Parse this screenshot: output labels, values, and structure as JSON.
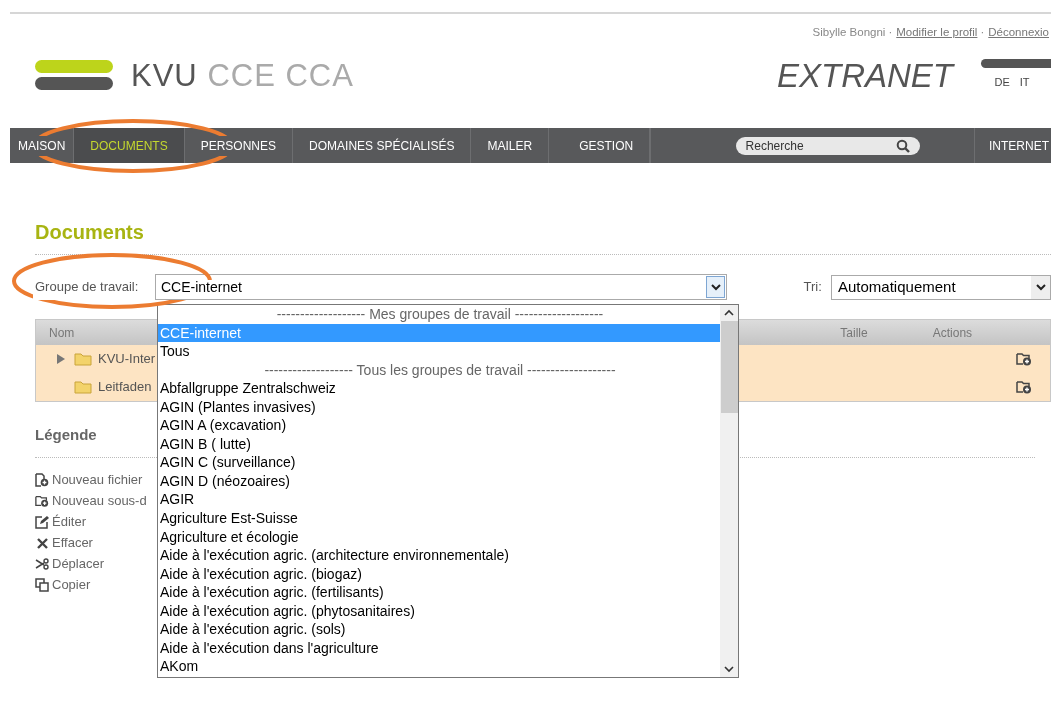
{
  "header": {
    "logo": {
      "primary": "KVU",
      "secondary": "CCE CCA"
    },
    "user": "Sibylle Bongni",
    "separator": "·",
    "links": [
      "Modifier le profil",
      "Déconnexio"
    ],
    "site_title": "EXTRANET",
    "languages": [
      "DE",
      "IT"
    ]
  },
  "nav": {
    "items": [
      {
        "label": "MAISON",
        "selected": false
      },
      {
        "label": "DOCUMENTS",
        "selected": true
      },
      {
        "label": "PERSONNES",
        "selected": false
      },
      {
        "label": "DOMAINES SPÉCIALISÉS",
        "selected": false
      },
      {
        "label": "MAILER",
        "selected": false
      },
      {
        "label": "GESTION",
        "selected": false
      }
    ],
    "search": {
      "placeholder": "Recherche"
    },
    "external_link": "INTERNET"
  },
  "page_title": "Documents",
  "filter": {
    "label": "Groupe de travail:",
    "value": "CCE-internet"
  },
  "sort": {
    "label": "Tri:",
    "value": "Automatiquement"
  },
  "table": {
    "columns": [
      "Nom",
      "Taille",
      "Actions"
    ],
    "rows": [
      {
        "name": "KVU-Inter",
        "expandable": true
      },
      {
        "name": "Leitfaden",
        "expandable": false
      }
    ]
  },
  "legend": {
    "title": "Légende",
    "items": [
      {
        "kind": "new-file",
        "label": "Nouveau fichier"
      },
      {
        "kind": "new-folder",
        "label": "Nouveau sous-d"
      },
      {
        "kind": "edit",
        "label": "Éditer"
      },
      {
        "kind": "delete",
        "label": "Effacer"
      },
      {
        "kind": "move",
        "label": "Déplacer"
      },
      {
        "kind": "copy",
        "label": "Copier"
      }
    ]
  },
  "dropdown": {
    "options": [
      {
        "kind": "group",
        "label": "------------------- Mes groupes de travail -------------------",
        "selected": false
      },
      {
        "kind": "option",
        "label": "CCE-internet",
        "selected": true
      },
      {
        "kind": "option",
        "label": "Tous",
        "selected": false
      },
      {
        "kind": "group",
        "label": "------------------- Tous les groupes de travail -------------------",
        "selected": false
      },
      {
        "kind": "option",
        "label": "Abfallgruppe Zentralschweiz",
        "selected": false
      },
      {
        "kind": "option",
        "label": "AGIN (Plantes invasives)",
        "selected": false
      },
      {
        "kind": "option",
        "label": "AGIN A (excavation)",
        "selected": false
      },
      {
        "kind": "option",
        "label": "AGIN B ( lutte)",
        "selected": false
      },
      {
        "kind": "option",
        "label": "AGIN C (surveillance)",
        "selected": false
      },
      {
        "kind": "option",
        "label": "AGIN D (néozoaires)",
        "selected": false
      },
      {
        "kind": "option",
        "label": "AGIR",
        "selected": false
      },
      {
        "kind": "option",
        "label": "Agriculture Est-Suisse",
        "selected": false
      },
      {
        "kind": "option",
        "label": "Agriculture et écologie",
        "selected": false
      },
      {
        "kind": "option",
        "label": "Aide à l'exécution agric. (architecture environnementale)",
        "selected": false
      },
      {
        "kind": "option",
        "label": "Aide à l'exécution agric. (biogaz)",
        "selected": false
      },
      {
        "kind": "option",
        "label": "Aide à l'exécution agric. (fertilisants)",
        "selected": false
      },
      {
        "kind": "option",
        "label": "Aide à l'exécution agric. (phytosanitaires)",
        "selected": false
      },
      {
        "kind": "option",
        "label": "Aide à l'exécution agric. (sols)",
        "selected": false
      },
      {
        "kind": "option",
        "label": "Aide à l'exécution dans l'agriculture",
        "selected": false
      },
      {
        "kind": "option",
        "label": "AKom",
        "selected": false
      }
    ]
  }
}
